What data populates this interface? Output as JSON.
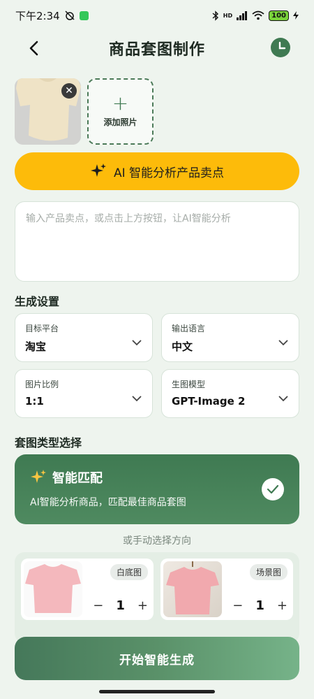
{
  "status_bar": {
    "time": "下午2:34",
    "network": "HD",
    "battery": "100"
  },
  "header": {
    "title": "商品套图制作"
  },
  "upload": {
    "add_label": "添加照片"
  },
  "ai_button": {
    "label": "AI 智能分析产品卖点"
  },
  "selling_points": {
    "placeholder": "输入产品卖点，或点击上方按钮，让AI智能分析"
  },
  "settings": {
    "title": "生成设置",
    "target_platform": {
      "label": "目标平台",
      "value": "淘宝"
    },
    "output_language": {
      "label": "输出语言",
      "value": "中文"
    },
    "aspect_ratio": {
      "label": "图片比例",
      "value": "1:1"
    },
    "model": {
      "label": "生图模型",
      "value": "GPT-Image 2"
    }
  },
  "set_types": {
    "title": "套图类型选择",
    "smart_match": {
      "title": "智能匹配",
      "desc": "AI智能分析商品，匹配最佳商品套图"
    },
    "manual_hint": "或手动选择方向",
    "items": [
      {
        "badge": "白底图",
        "count": "1",
        "minus": "−",
        "plus": "+"
      },
      {
        "badge": "场景图",
        "count": "1",
        "minus": "−",
        "plus": "+"
      }
    ]
  },
  "start_button": {
    "label": "开始智能生成"
  },
  "colors": {
    "primary_green": "#3f7a52",
    "accent_yellow": "#fdbb0a",
    "background": "#eef4ee"
  }
}
